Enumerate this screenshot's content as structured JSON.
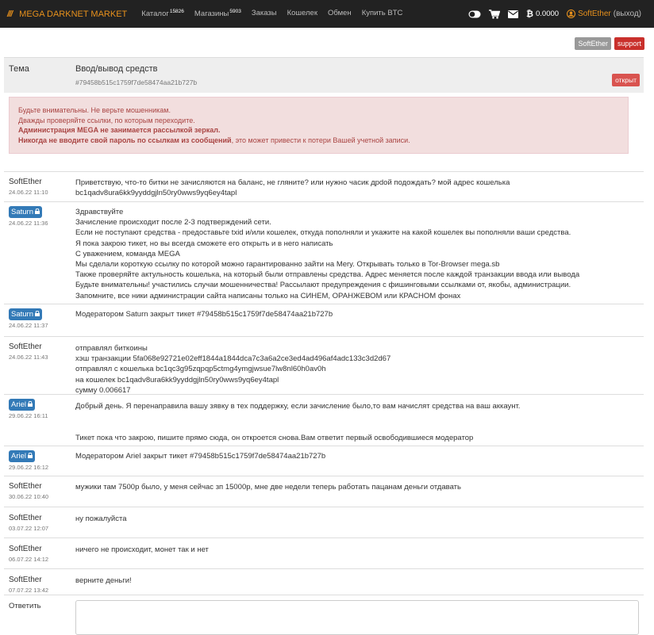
{
  "navbar": {
    "brand_slash": "///",
    "brand": "MEGA DARKNET MARKET",
    "links": [
      {
        "label": "Каталог",
        "count": "15826"
      },
      {
        "label": "Магазины",
        "count": "5903"
      },
      {
        "label": "Заказы",
        "count": ""
      },
      {
        "label": "Кошелек",
        "count": ""
      },
      {
        "label": "Обмен",
        "count": ""
      },
      {
        "label": "Купить BTC",
        "count": ""
      }
    ],
    "balance": "0.0000",
    "username": "SoftEther",
    "logout": "(выход)",
    "icons": [
      "toggle-icon",
      "cart-icon",
      "envelope-icon",
      "bitcoin-icon",
      "user-icon"
    ]
  },
  "top_buttons": {
    "user": "SoftEther",
    "support": "support"
  },
  "ticket": {
    "subject_label": "Тема",
    "title": "Ввод/вывод средств",
    "id": "#79458b515c1759f7de58474aa21b727b",
    "status": "открыт"
  },
  "alert": {
    "line1": "Будьте внимательны. Не верьте мошенникам.",
    "line2": "Дважды проверяйте ссылки, по которым переходите.",
    "line3": "Администрация MEGA не занимается рассылкой зеркал.",
    "line4_bold": "Никогда не вводите свой пароль по ссылкам из сообщений",
    "line4_rest": ", это может привести к потери Вашей учетной записи."
  },
  "messages": [
    {
      "author": "SoftEther",
      "staff": false,
      "date": "24.06.22 11:10",
      "lines": [
        "Приветствую, что-то битки не зачисляются на баланс, не гляните? или нужно часик дрdой подождать? мой адрес кошелька",
        "bc1qadv8ura6kk9yyddgjln50ry0wws9yq6ey4tapl"
      ]
    },
    {
      "author": "Saturn",
      "staff": true,
      "date": "24.06.22 11:36",
      "lines": [
        "Здравствуйте",
        "Зачисление происходит после 2-3 подтверждений сети.",
        "Если не поступают средства - предоставьте txid и/или кошелек, откуда пополняли и укажите на какой кошелек вы пополняли ваши средства.",
        "Я пока закрою тикет, но вы всегда сможете его открыть и в него написать",
        "С уважением, команда MEGA",
        "Мы сделали короткую ссылку по которой можно гарантированно зайти на Mery. Открывать только в Tor-Browser mega.sb",
        "Также проверяйте актульность кошелька, на который были отправлены средства. Адрес меняется после каждой транзакции ввода или вывода",
        "Будьте внимательны! участились случаи мошенничества! Рассылают предупреждения с фишинговыми ссылками от, якобы, администрации.",
        "Запомните, все ники администрации сайта написаны только на СИНЕМ, ОРАНЖЕВОМ или КРАСНОМ фонах"
      ]
    },
    {
      "author": "Saturn",
      "staff": true,
      "date": "24.06.22 11:37",
      "lines": [
        "Модератором Saturn закрыт тикет #79458b515c1759f7de58474aa21b727b"
      ]
    },
    {
      "author": "SoftEther",
      "staff": false,
      "date": "24.06.22 11:43",
      "lines": [
        "отправлял биткоины",
        "хэш транзакции 5fa068e92721e02eff1844a1844dca7c3a6a2ce3ed4ad496af4adc133c3d2d67",
        "отправлял с кошелька bc1qc3g95zqpqp5ctmg4ymgjwsue7lw8nl60h0av0h",
        "на кошелек bc1qadv8ura6kk9yyddgjln50ry0wws9yq6ey4tapl",
        "сумму 0.006617"
      ]
    },
    {
      "author": "Ariel",
      "staff": true,
      "date": "29.06.22 16:11",
      "lines": [
        "Добрый день. Я перенаправила вашу зявку в тех поддержку, если зачисление было,то вам начислят средства на ваш аккаунт.",
        "",
        "",
        "Тикет пока что закрою, пишите прямо сюда, он откроется снова.Вам ответит первый освободившиеся модератор"
      ]
    },
    {
      "author": "Ariel",
      "staff": true,
      "date": "29.06.22 16:12",
      "lines": [
        "Модератором Ariel закрыт тикет #79458b515c1759f7de58474aa21b727b"
      ]
    },
    {
      "author": "SoftEther",
      "staff": false,
      "date": "30.06.22 10:40",
      "lines": [
        "мужики там 7500р было, у меня сейчас зп 15000р, мне две недели теперь работать пацанам деньги отдавать"
      ]
    },
    {
      "author": "SoftEther",
      "staff": false,
      "date": "03.07.22 12:07",
      "lines": [
        "ну пожалуйста"
      ]
    },
    {
      "author": "SoftEther",
      "staff": false,
      "date": "06.07.22 14:12",
      "lines": [
        "ничего не происходит, монет так и нет"
      ]
    },
    {
      "author": "SoftEther",
      "staff": false,
      "date": "07.07.22 13:42",
      "lines": [
        "верните деньги!"
      ]
    }
  ],
  "reply": {
    "label": "Ответить",
    "value": ""
  }
}
